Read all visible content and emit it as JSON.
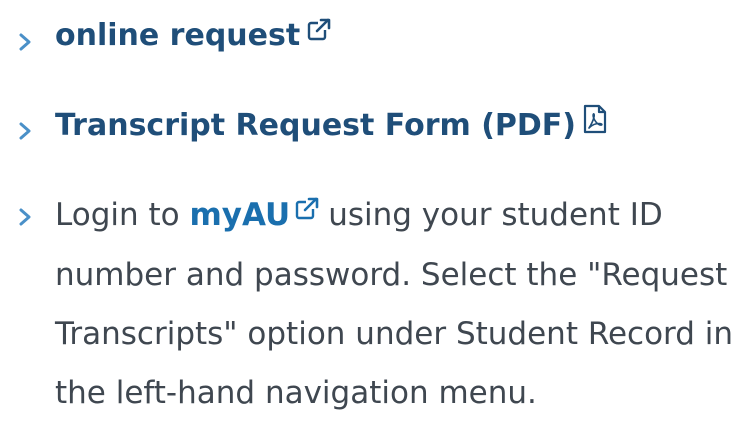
{
  "items": [
    {
      "link_text": "online request",
      "icon": "external-link-icon"
    },
    {
      "link_text": "Transcript Request Form (PDF)",
      "icon": "pdf-icon"
    },
    {
      "prefix": "Login to",
      "link_text": "myAU",
      "icon": "external-link-icon",
      "suffix": "using your student ID number and password. Select the \"Request Transcripts\" option under Student Record in the left-hand navigation menu."
    }
  ],
  "colors": {
    "link": "#1f4e79",
    "inline_link": "#1a6fae",
    "bullet": "#4a90c8",
    "text": "#3f4750"
  }
}
